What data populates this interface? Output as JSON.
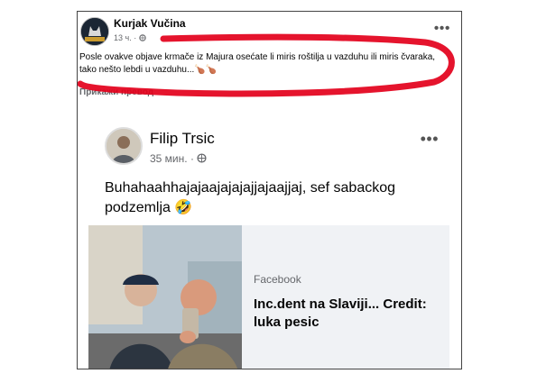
{
  "post": {
    "author": "Kurjak Vučina",
    "avatar_text": "KURJAK",
    "time": "13 ч.",
    "body": "Posle ovakve objave krmače iz Majura osećate li miris roštilja u vazduhu ili miris čvaraka, tako nešto lebdi u vazduhu...🍗🍗",
    "translate_label": "Прикажи превод",
    "more_icon": "more-dots-icon",
    "audience_icon": "globe-icon"
  },
  "shared_post": {
    "author": "Filip Trsic",
    "time": "35 мин.",
    "body": "Buhahaahhajajaajajajajjajaajjaj, sef sabackog podzemlja 🤣",
    "audience_icon": "globe-icon",
    "more_icon": "more-dots-icon"
  },
  "link_preview": {
    "source": "Facebook",
    "title": "Inc.dent na Slaviji... Credit: luka pesic"
  },
  "colors": {
    "highlight_red": "#e3001b",
    "text": "#050505",
    "muted": "#65676b"
  }
}
